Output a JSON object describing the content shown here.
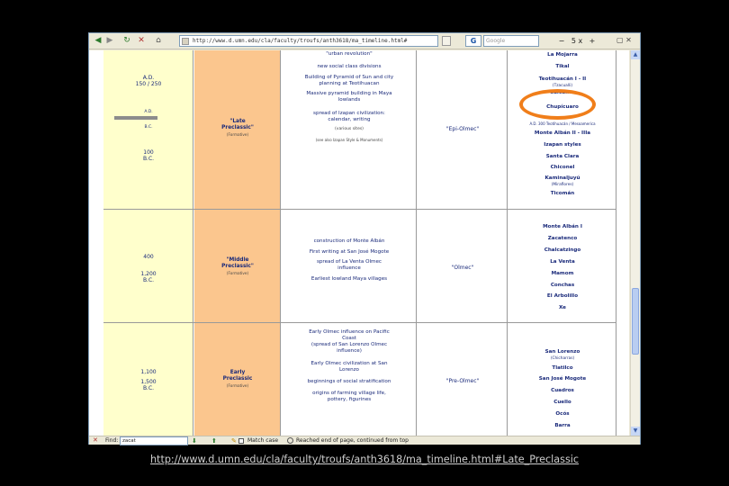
{
  "toolbar": {
    "back_icon": "back-arrow-icon",
    "forward_icon": "forward-arrow-icon",
    "reload_icon": "reload-icon",
    "stop_icon": "stop-icon",
    "home_icon": "home-icon",
    "url": "http://www.d.umn.edu/cla/faculty/troufs/anth3618/ma_timeline.html#",
    "search_engine": "G",
    "search_placeholder": "Google",
    "zoom_value": "5 x"
  },
  "timeline": {
    "dates": [
      {
        "label": "A.D.\n150 / 250"
      },
      {
        "label": "A.D."
      },
      {
        "label": "B.C."
      },
      {
        "label": "100\nB.C."
      },
      {
        "label": "400"
      },
      {
        "label": "1,200\nB.C."
      },
      {
        "label": "1,100"
      },
      {
        "label": "1,500\nB.C."
      }
    ],
    "periods": [
      {
        "name": "\"Late\nPreclassic\"",
        "sub": "(Formative)"
      },
      {
        "name": "\"Middle\nPreclassic\"",
        "sub": "(Formative)"
      },
      {
        "name": "Early\nPreclassic",
        "sub": "(Formative)"
      }
    ],
    "olmec": [
      "\"Epi-Olmec\"",
      "\"Olmec\"",
      "\"Pre-Olmec\""
    ],
    "events_late": [
      "\"urban revolution\"",
      "new social class divisions",
      "Building of Pyramid of Sun and city\nplanning at Teotihuacan",
      "Massive pyramid building in Maya\nlowlands",
      "spread of Izapan civilization:\ncalendar, writing",
      "(various sites)",
      "(see also Izapan Style & Monuments)"
    ],
    "events_middle": [
      "construction of Monte Albán",
      "First writing at San José Mogote",
      "spread of La Venta Olmec\ninfluence",
      "Earliest lowland Maya villages"
    ],
    "events_early": [
      "Early Olmec influence on Pacific\nCoast\n(spread of San Lorenzo Olmec\ninfluence)",
      "Early Olmec civilization at San\nLorenzo",
      "beginnings of social stratification",
      "origins of farming village life,\npottery, figurines"
    ],
    "sites_late": [
      "La Mojarra",
      "Tikal",
      "Teotihuacán I - II",
      "(Tzacualli)",
      "Cuicuilco",
      "Chupícuaro",
      "A.D. 300 Teotihuacán / Mesoamerica",
      "Monte Albán II - IIIa",
      "Izapan styles",
      "Santa Clara",
      "Chiconel",
      "Kaminaljuyú",
      "(Miraflores)",
      "Ticomán"
    ],
    "sites_middle": [
      "Monte Albán I",
      "Zacatenco",
      "Chalcatzingo",
      "La Venta",
      "Mamom",
      "Conchas",
      "El Arbolillo",
      "Xe"
    ],
    "sites_early": [
      "San Lorenzo",
      "(Chicharras)",
      "Tlatilco",
      "San José Mogote",
      "Cuadros",
      "Cuello",
      "Ocós",
      "Barra"
    ]
  },
  "findbar": {
    "label": "Find:",
    "value": "zacat",
    "match_case": "Match case",
    "status": "Reached end of page, continued from top"
  },
  "caption": "http://www.d.umn.edu/cla/faculty/troufs/anth3618/ma_timeline.html#Late_Preclassic",
  "colors": {
    "date_col": "#ffffcc",
    "period_col": "#fbc68e",
    "ring": "#f07e1a",
    "text": "#1a2a7a"
  }
}
